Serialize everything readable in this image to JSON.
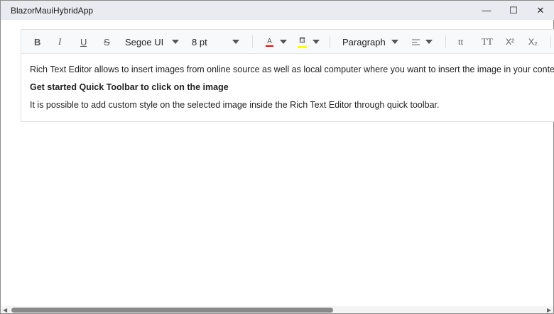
{
  "window": {
    "title": "BlazorMauiHybridApp",
    "minimize": "—",
    "maximize": "☐",
    "close": "✕"
  },
  "toolbar": {
    "bold": "B",
    "italic": "I",
    "underline": "U",
    "strikethrough": "S",
    "font_name": "Segoe UI",
    "font_size": "8 pt",
    "font_color": "A",
    "font_color_value": "#ff0000",
    "bg_color_value": "#ffff00",
    "format": "Paragraph",
    "lower_case": "tt",
    "upper_case": "TT",
    "superscript": "X²",
    "subscript": "X₂"
  },
  "content": {
    "p1": "Rich Text Editor allows to insert images from online source as well as local computer where you want to insert the image in your content.",
    "p2": "Get started Quick Toolbar to click on the image",
    "p3": "It is possible to add custom style on the selected image inside the Rich Text Editor through quick toolbar."
  }
}
